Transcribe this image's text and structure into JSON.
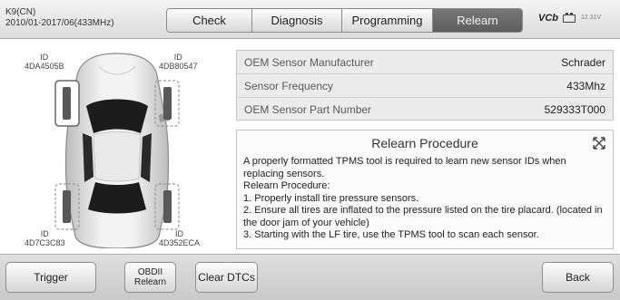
{
  "header": {
    "vehicle_model": "K9(CN)",
    "vehicle_years": "2010/01-2017/06(433MHz)",
    "tabs": [
      {
        "label": "Check"
      },
      {
        "label": "Diagnosis"
      },
      {
        "label": "Programming"
      },
      {
        "label": "Relearn",
        "active": true
      }
    ],
    "vci_label": "VCb",
    "battery_icon": "battery-icon",
    "voltage": "12.31V"
  },
  "tires": {
    "front_left": {
      "id_label": "ID",
      "id": "4DA4505B"
    },
    "front_right": {
      "id_label": "ID",
      "id": "4DB80547"
    },
    "rear_left": {
      "id_label": "ID",
      "id": "4D7C3C83"
    },
    "rear_right": {
      "id_label": "ID",
      "id": "4D352ECA"
    }
  },
  "sensor_info": [
    {
      "label": "OEM Sensor Manufacturer",
      "value": "Schrader"
    },
    {
      "label": "Sensor Frequency",
      "value": "433Mhz"
    },
    {
      "label": "OEM Sensor Part Number",
      "value": "529333T000"
    }
  ],
  "procedure": {
    "title": "Relearn Procedure",
    "lines": [
      "A properly formatted TPMS tool is required to learn new sensor IDs when replacing sensors.",
      "Relearn Procedure:",
      "1. Properly install tire pressure sensors.",
      "2. Ensure all tires are inflated to the pressure listed on the tire placard. (located in the door jam of your vehicle)",
      "3. Starting with the LF tire, use the TPMS tool to scan each sensor."
    ]
  },
  "footer": {
    "trigger": "Trigger",
    "obdii_relearn_line1": "OBDII",
    "obdii_relearn_line2": "Relearn",
    "clear_dtcs": "Clear DTCs",
    "back": "Back"
  },
  "colors": {
    "active_tab": "#6a6a6a",
    "header_bg": "#e6e6e6",
    "footer_bg": "#d2d2d2"
  }
}
